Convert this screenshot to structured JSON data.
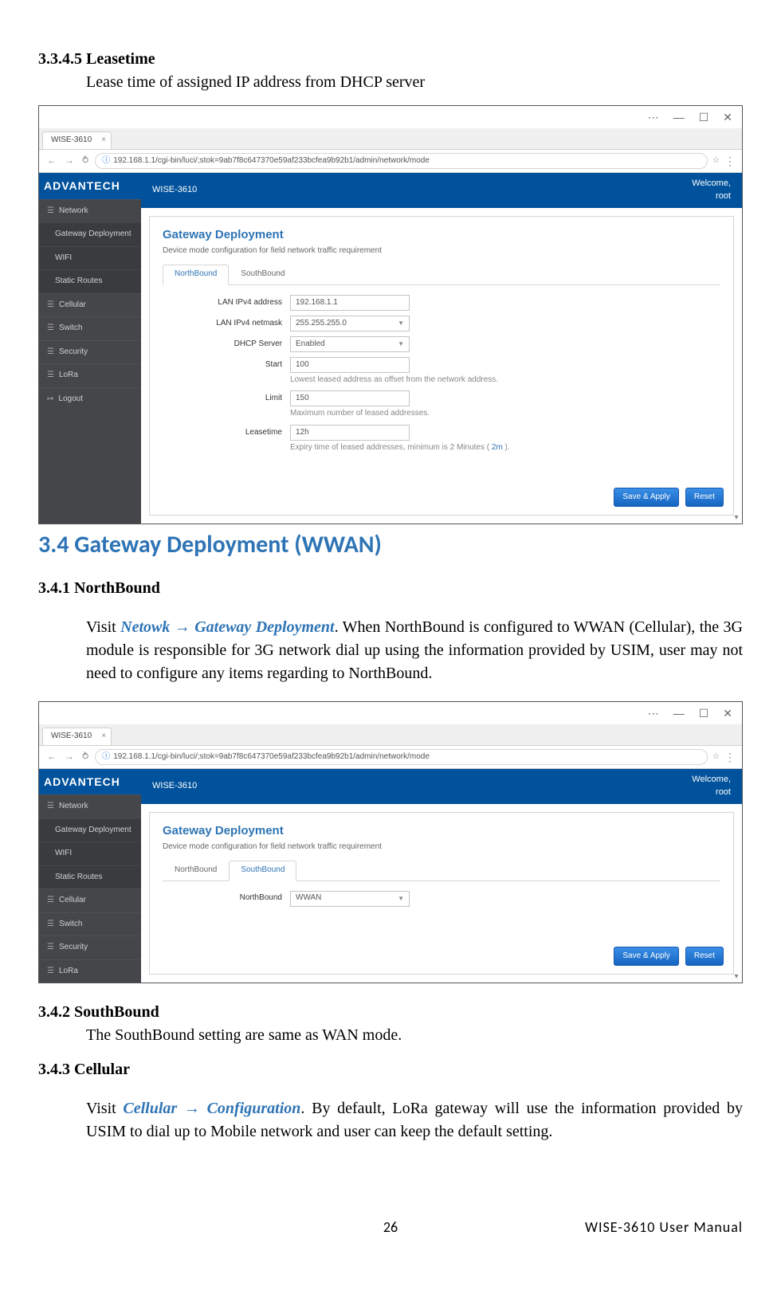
{
  "section_3345": {
    "heading": "3.3.4.5 Leasetime",
    "desc": "Lease time of assigned IP address from DHCP server"
  },
  "section_34": "3.4 Gateway Deployment (WWAN)",
  "section_341": {
    "heading": "3.4.1 NorthBound",
    "pre": "Visit ",
    "navref": "Netowk → Gateway Deployment",
    "post": ". When NorthBound is configured to WWAN (Cellular), the 3G module is responsible for 3G network dial up using the information provided by USIM, user may not need to configure any items regarding to NorthBound."
  },
  "section_342": {
    "heading": "3.4.2 SouthBound",
    "desc": "The SouthBound setting are same as WAN mode."
  },
  "section_343": {
    "heading": "3.4.3 Cellular",
    "pre": "Visit ",
    "navref": "Cellular → Configuration",
    "post": ". By default, LoRa gateway will use the information provided by USIM to dial up to Mobile network and user can keep the default setting."
  },
  "footer": {
    "page": "26",
    "doc": "WISE-3610 User Manual"
  },
  "shot_common": {
    "tab_title": "WISE-3610",
    "url": "192.168.1.1/cgi-bin/luci/;stok=9ab7f8c647370e59af233bcfea9b92b1/admin/network/mode",
    "logo": "ADVANTECH",
    "topbar_title": "WISE-3610",
    "welcome": "Welcome,",
    "user": "root",
    "content_title": "Gateway Deployment",
    "content_sub": "Device mode configuration for field network traffic requirement",
    "btn_save": "Save & Apply",
    "btn_reset": "Reset"
  },
  "sidebar": {
    "network": "Network",
    "gwdep": "Gateway Deployment",
    "wifi": "WIFI",
    "static": "Static Routes",
    "cellular": "Cellular",
    "switch": "Switch",
    "security": "Security",
    "lora": "LoRa",
    "logout": "Logout"
  },
  "shot1": {
    "tab_nb": "NorthBound",
    "tab_sb": "SouthBound",
    "lbl_ip": "LAN IPv4 address",
    "val_ip": "192.168.1.1",
    "lbl_nm": "LAN IPv4 netmask",
    "val_nm": "255.255.255.0",
    "lbl_dhcp": "DHCP Server",
    "val_dhcp": "Enabled",
    "lbl_start": "Start",
    "val_start": "100",
    "hint_start": "Lowest leased address as offset from the network address.",
    "lbl_limit": "Limit",
    "val_limit": "150",
    "hint_limit": "Maximum number of leased addresses.",
    "lbl_lease": "Leasetime",
    "val_lease": "12h",
    "hint_lease_pre": "Expiry time of leased addresses, minimum is 2 Minutes ( ",
    "hint_lease_link": "2m",
    "hint_lease_post": " )."
  },
  "shot2": {
    "tab_nb": "NorthBound",
    "tab_sb": "SouthBound",
    "lbl_nb": "NorthBound",
    "val_nb": "WWAN"
  }
}
